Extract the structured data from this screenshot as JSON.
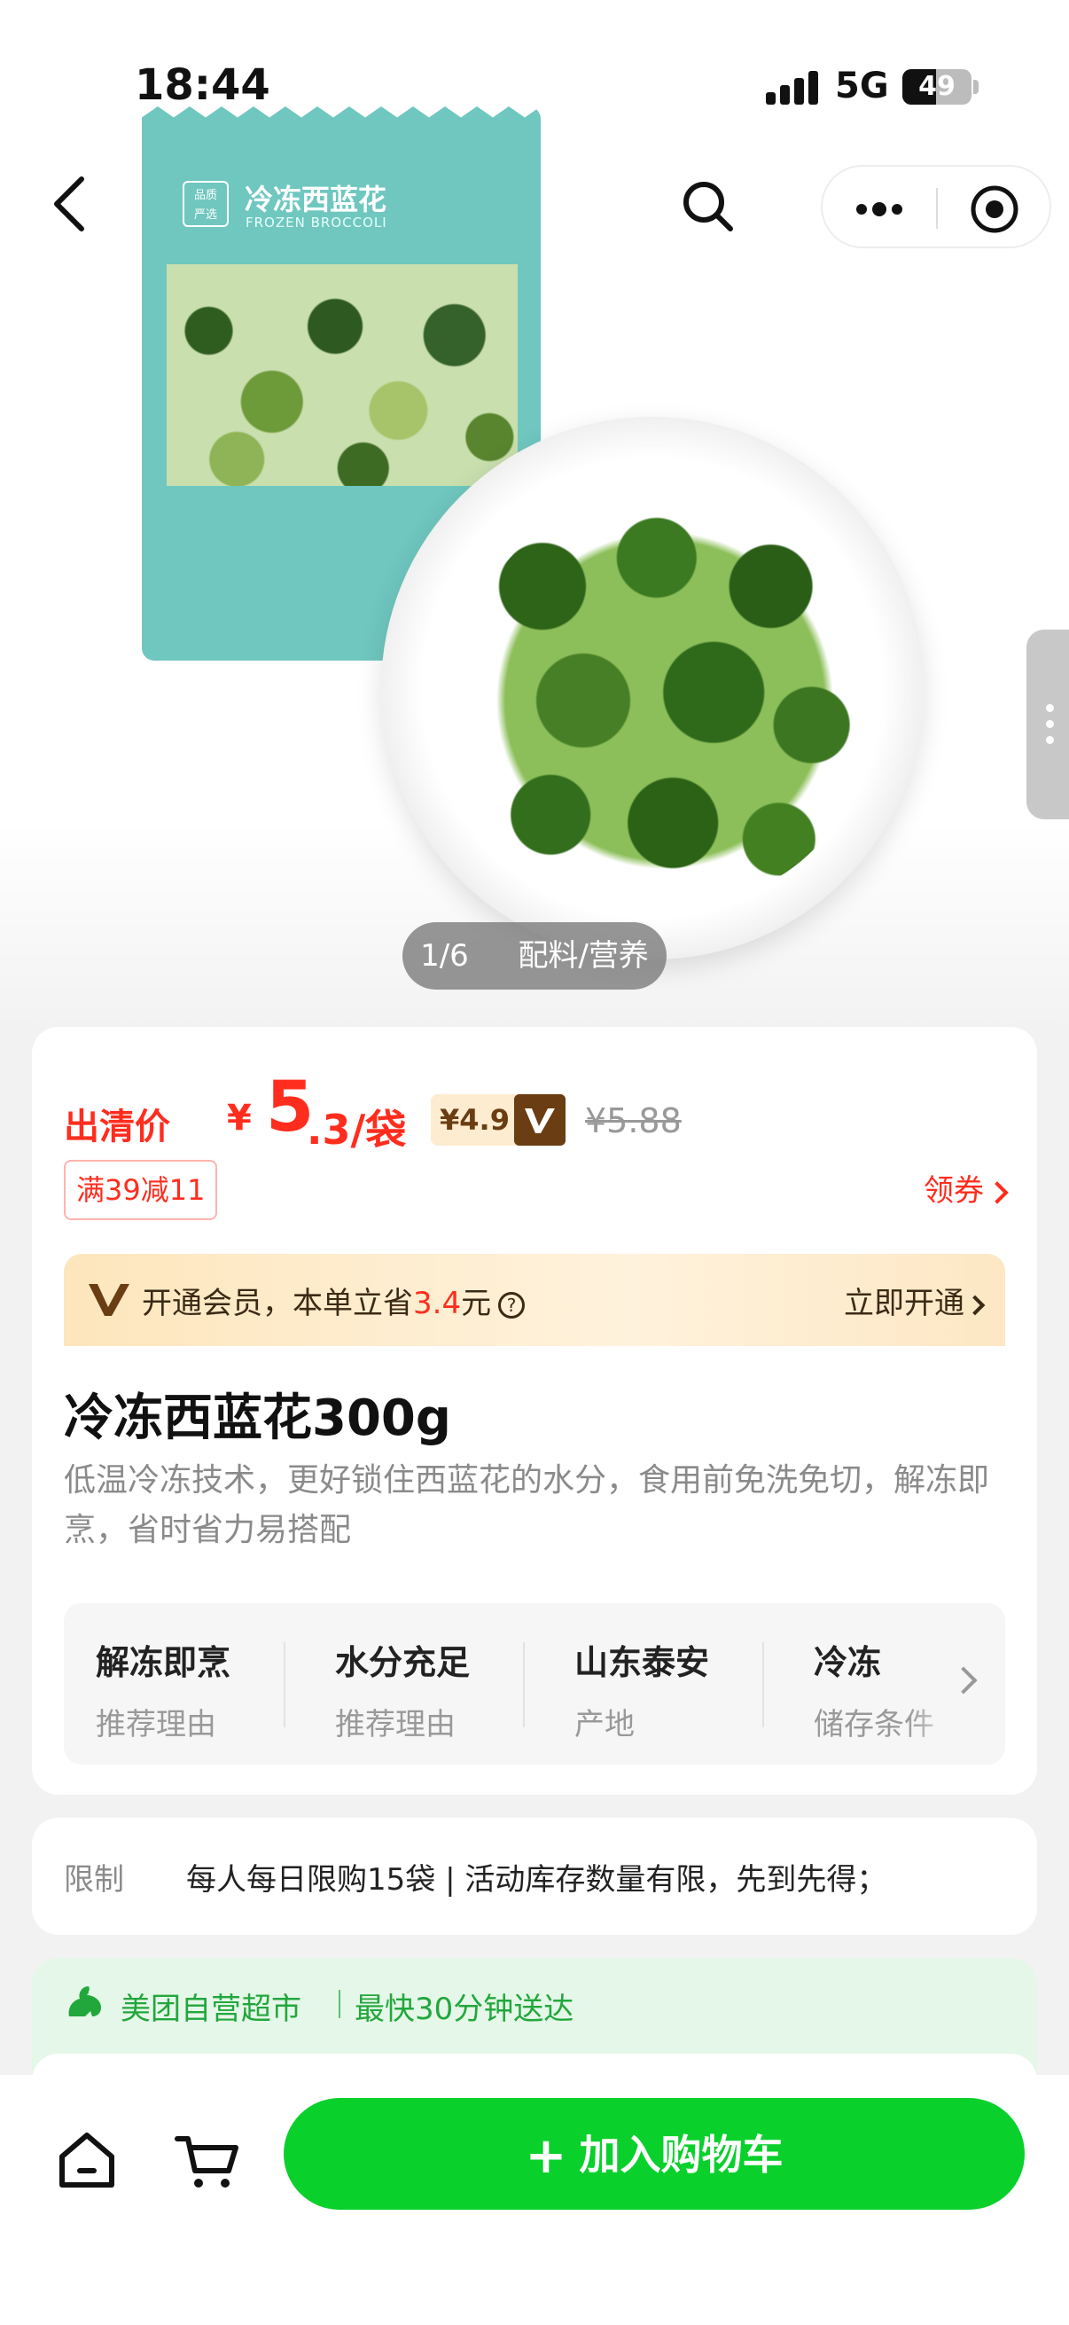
{
  "status_bar": {
    "time": "18:44",
    "network": "5G",
    "battery_level": "49",
    "battery_fraction": 0.49
  },
  "hero": {
    "bag_badge": "品质\n严选",
    "bag_title": "冷冻西蓝花",
    "bag_subtitle": "FROZEN BROCCOLI",
    "counter": "1/6",
    "tab": "配料/营养"
  },
  "price": {
    "label": "出清价",
    "currency": "¥",
    "integer": "5",
    "decimal_unit": ".3/袋",
    "vip_price": "¥4.9",
    "original_price": "¥5.88",
    "coupon_tag": "满39减11",
    "get_coupon": "领券"
  },
  "member": {
    "text_before": "开通会员，本单立省",
    "amount": "3.4",
    "text_after": "元",
    "help_icon": "question-circle-icon",
    "cta": "立即开通"
  },
  "product": {
    "title": "冷冻西蓝花300g",
    "description": "低温冷冻技术，更好锁住西蓝花的水分，食用前免洗免切，解冻即烹，省时省力易搭配"
  },
  "attributes": [
    {
      "value": "解冻即烹",
      "label": "推荐理由"
    },
    {
      "value": "水分充足",
      "label": "推荐理由"
    },
    {
      "value": "山东泰安",
      "label": "产地"
    },
    {
      "value": "冷冻",
      "label": "储存条件"
    }
  ],
  "limit": {
    "label": "限制",
    "text": "每人每日限购15袋 | 活动库存数量有限，先到先得；"
  },
  "delivery": {
    "store": "美团自营超市",
    "eta": "最快30分钟送达",
    "accent": "#22a73c"
  },
  "bottom_bar": {
    "add_to_cart": "加入购物车",
    "accent": "#0ad02c"
  },
  "colors": {
    "price_red": "#ff2d1e",
    "member_brown": "#6a3d12"
  }
}
